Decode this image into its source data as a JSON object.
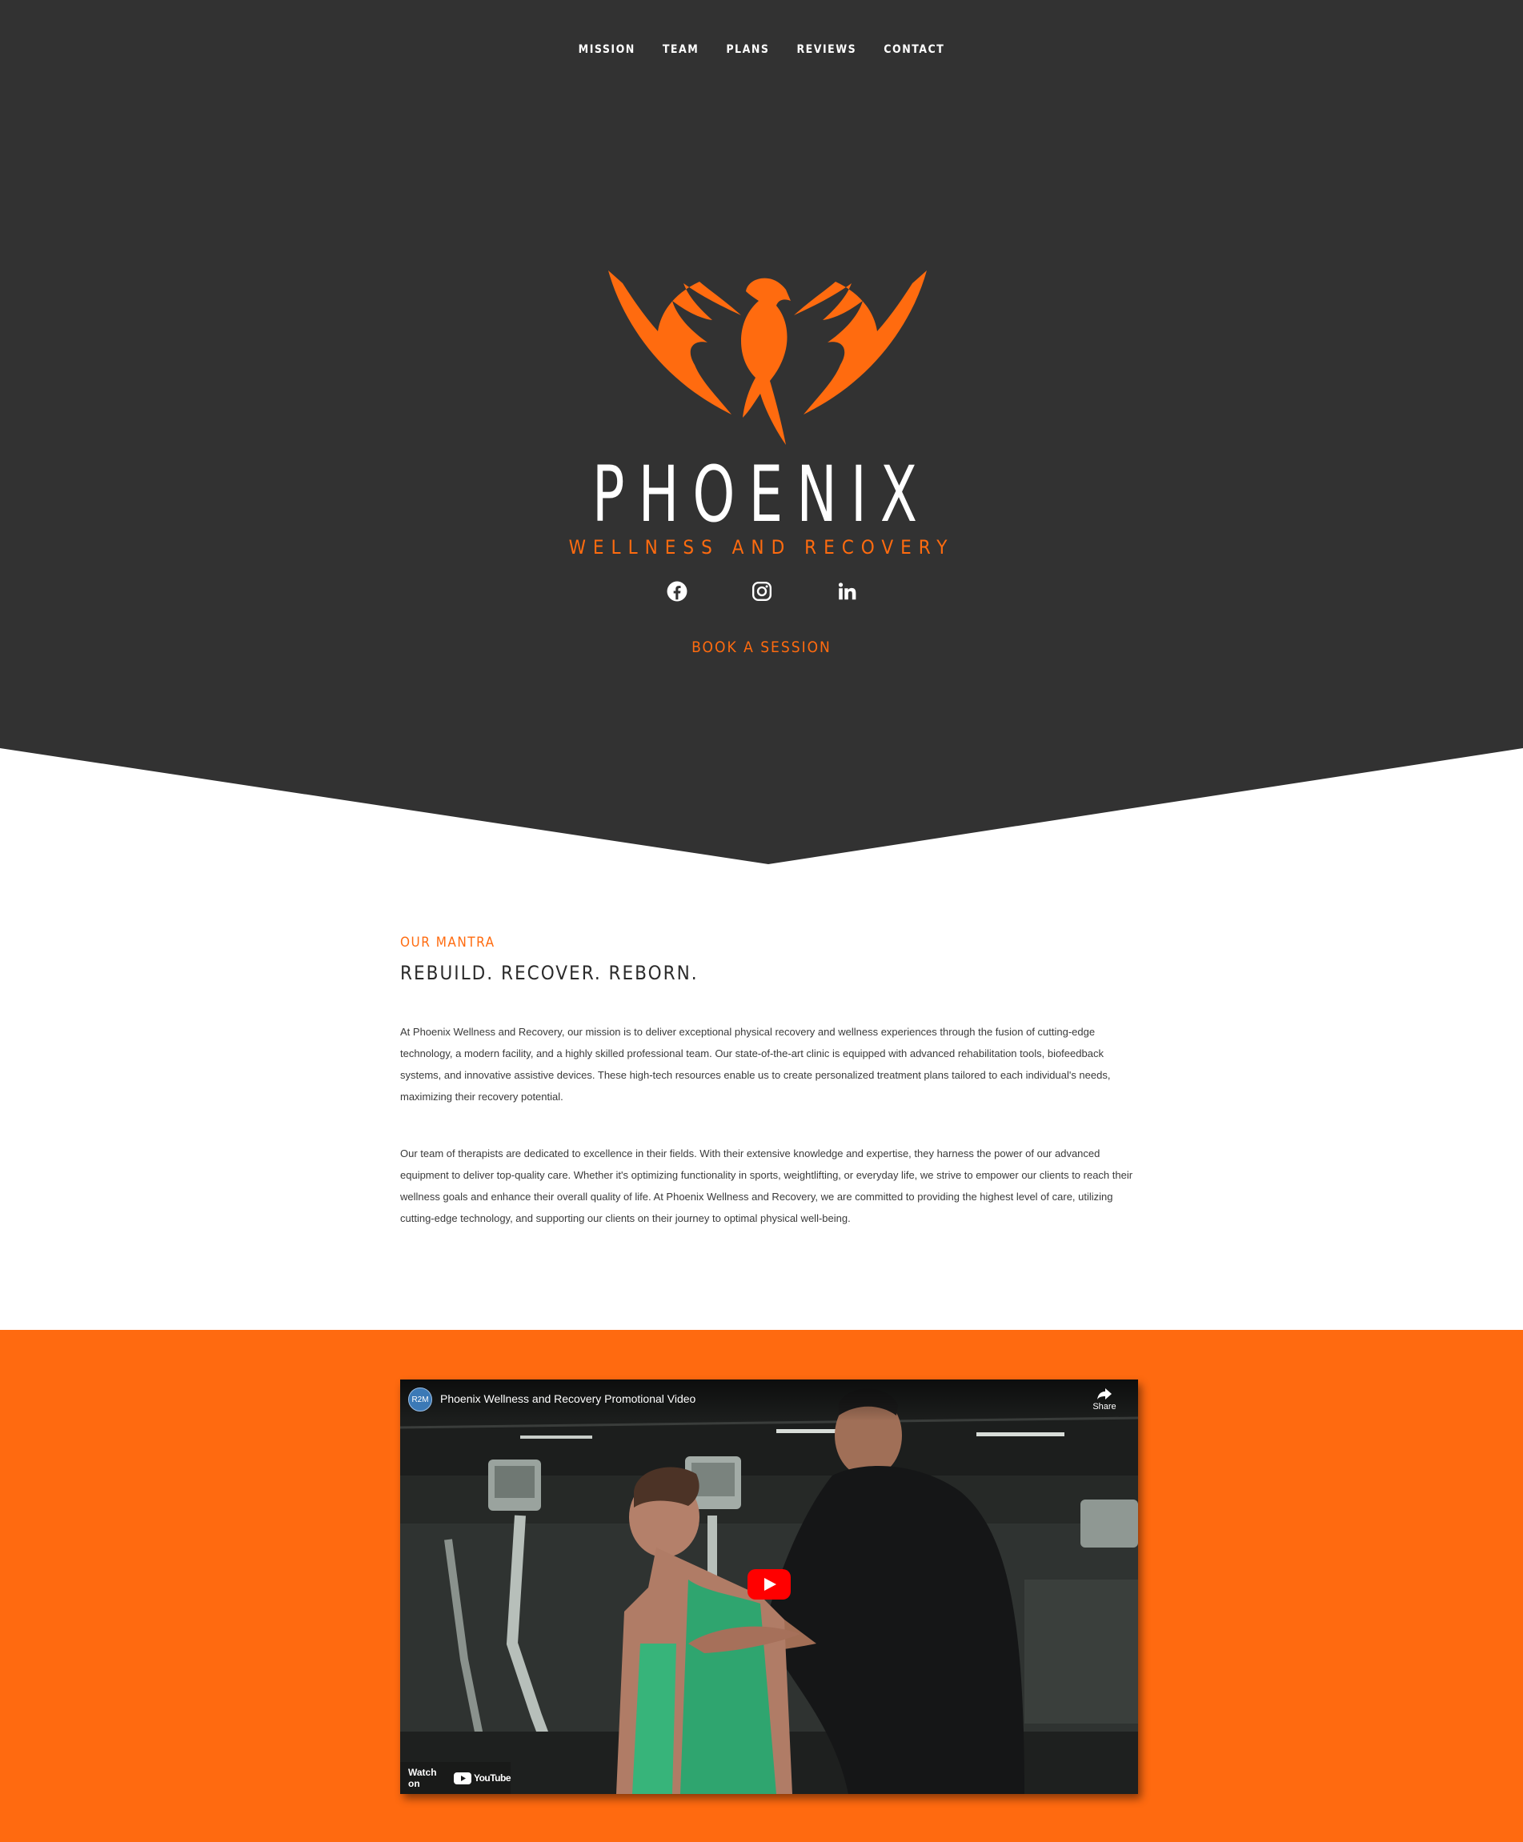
{
  "nav": {
    "items": [
      {
        "label": "MISSION"
      },
      {
        "label": "TEAM"
      },
      {
        "label": "PLANS"
      },
      {
        "label": "REVIEWS"
      },
      {
        "label": "CONTACT"
      }
    ]
  },
  "brand": {
    "name": "PHOENIX",
    "tagline": "WELLNESS AND RECOVERY",
    "logo_icon": "phoenix-bird-icon"
  },
  "socials": [
    {
      "icon": "facebook-icon"
    },
    {
      "icon": "instagram-icon"
    },
    {
      "icon": "linkedin-icon"
    }
  ],
  "cta": {
    "label": "BOOK A SESSION"
  },
  "mantra": {
    "eyebrow": "OUR MANTRA",
    "headline": "REBUILD. RECOVER. REBORN.",
    "paragraphs": [
      "At Phoenix Wellness and Recovery, our mission is to deliver exceptional physical recovery and wellness experiences through the fusion of cutting-edge technology, a modern facility, and a highly skilled professional team. Our state-of-the-art clinic is equipped with advanced rehabilitation tools, biofeedback systems, and innovative assistive devices. These high-tech resources enable us to create personalized treatment plans tailored to each individual's needs, maximizing their recovery potential.",
      "Our team of therapists are dedicated to excellence in their fields. With their extensive knowledge and expertise, they harness the power of our advanced equipment to deliver top-quality care. Whether it's optimizing functionality in sports, weightlifting, or everyday life, we strive to empower our clients to reach their wellness goals and enhance their overall quality of life. At Phoenix Wellness and Recovery, we are committed to providing the highest level of care, utilizing cutting-edge technology, and supporting our clients on their journey to optimal physical well-being."
    ]
  },
  "video": {
    "channel_badge": "R2M",
    "title": "Phoenix Wellness and Recovery Promotional Video",
    "share_label": "Share",
    "watch_on": "Watch on",
    "platform": "YouTube"
  },
  "colors": {
    "dark": "#323232",
    "accent": "#ff6b0f",
    "white": "#ffffff"
  }
}
